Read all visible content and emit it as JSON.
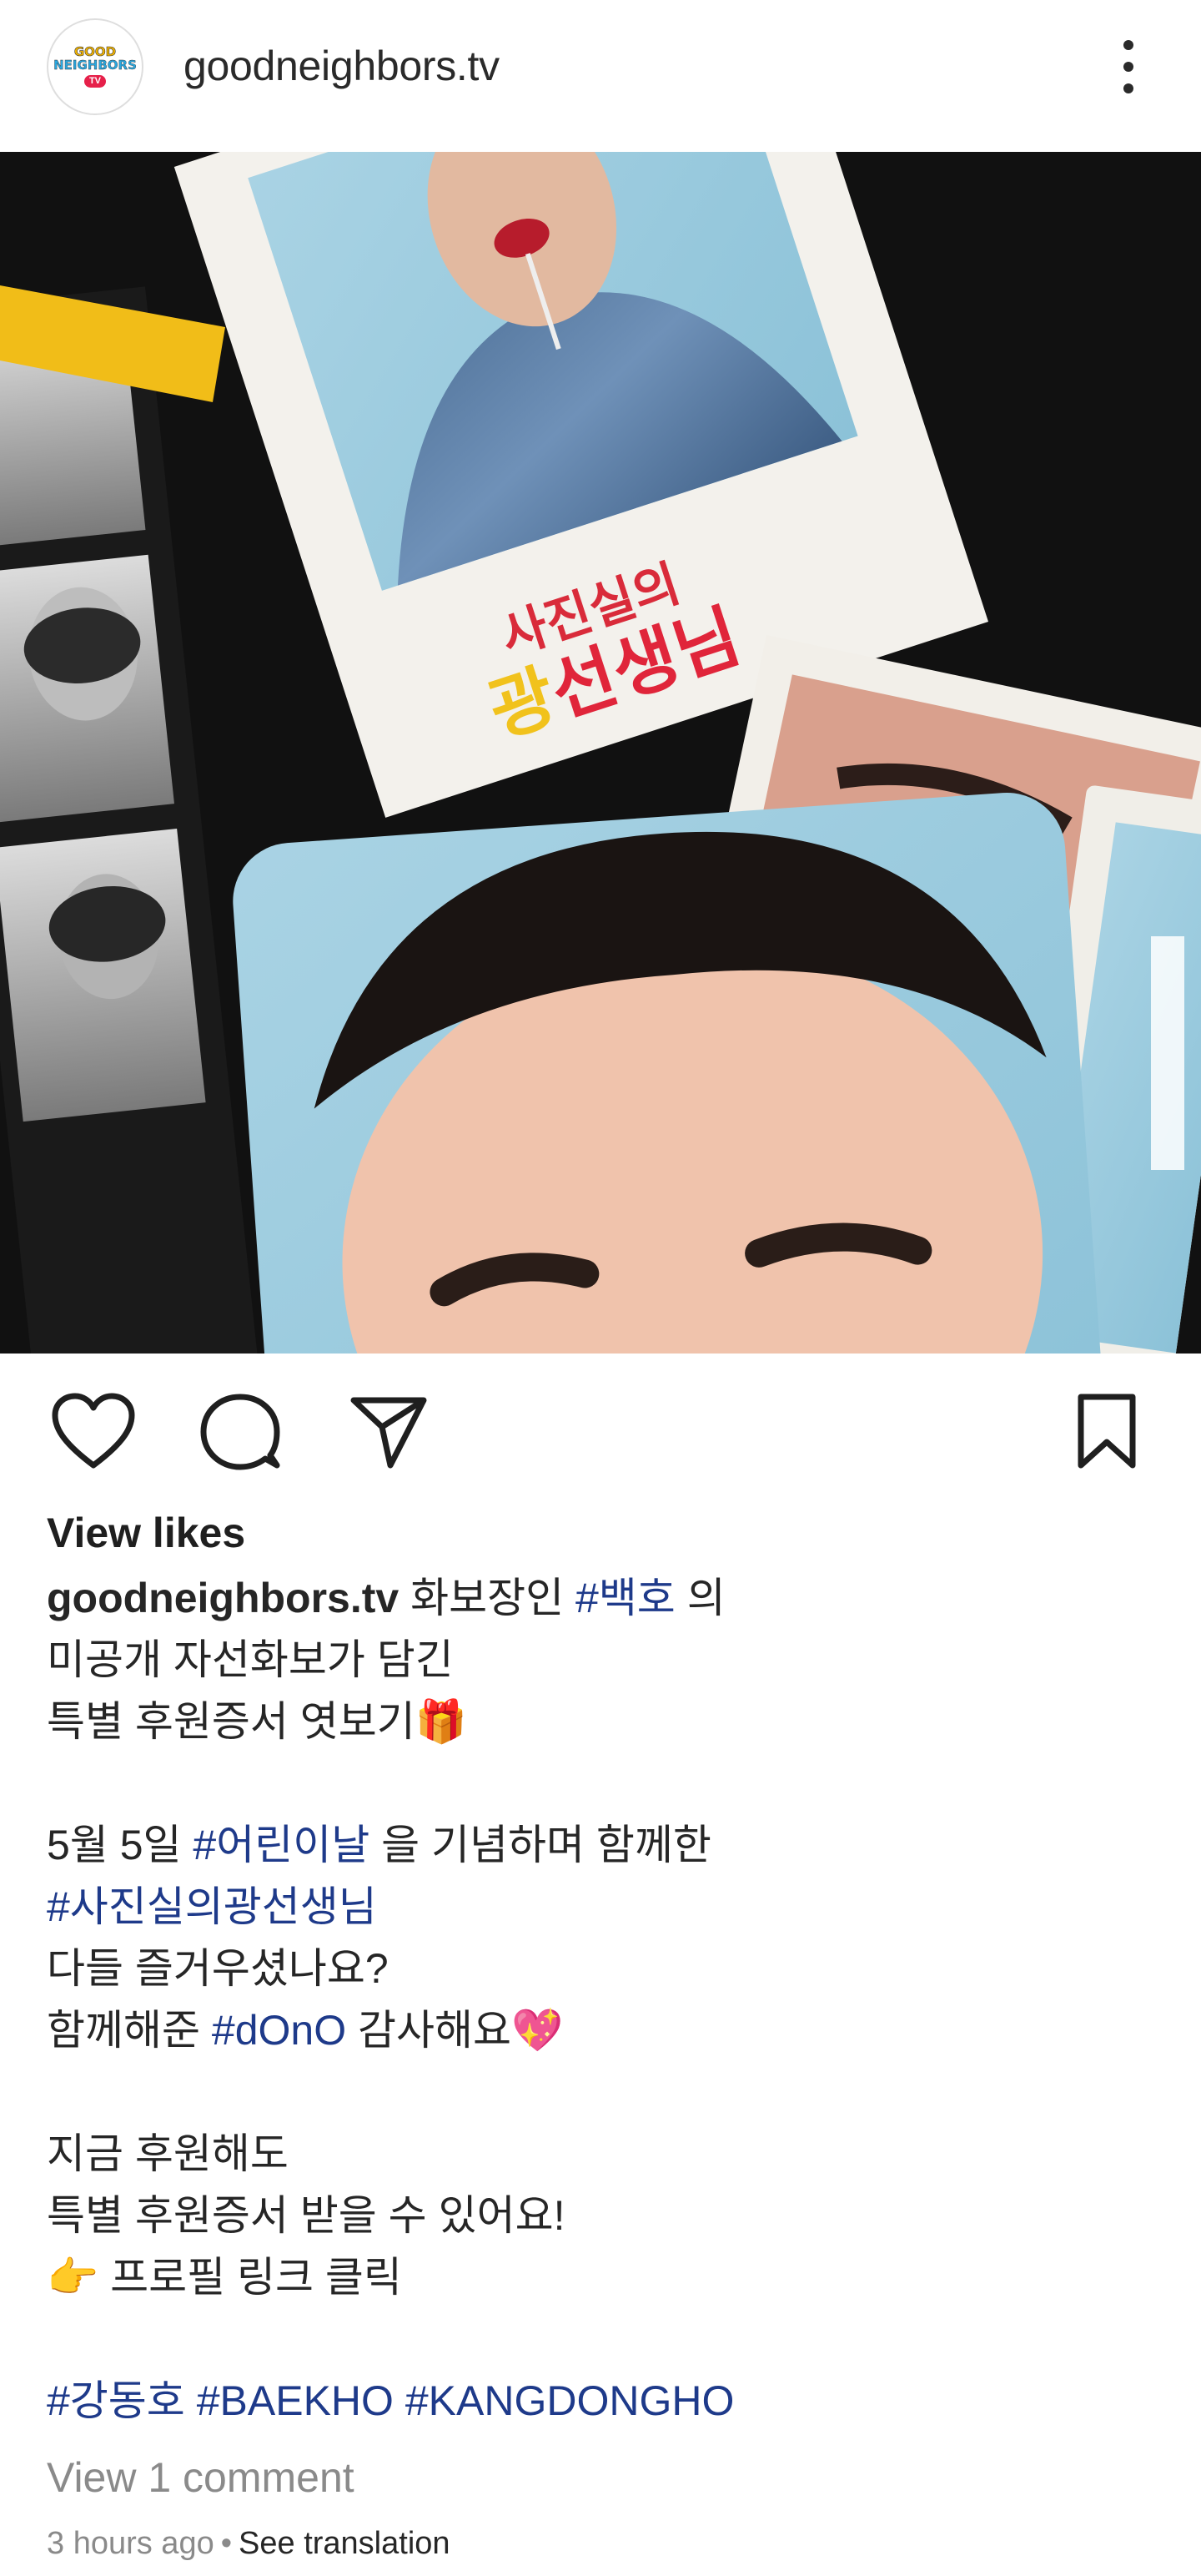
{
  "header": {
    "avatar_text": [
      "GOOD",
      "NEIGHBORS",
      "TV"
    ],
    "username": "goodneighbors.tv"
  },
  "post": {
    "photo_text": [
      "사진실의",
      "광",
      "선생님"
    ],
    "view_likes": "View likes",
    "caption": {
      "username": "goodneighbors.tv",
      "lines": [
        [
          " 화보장인 ",
          {
            "tag": "#백호"
          },
          " 의"
        ],
        [
          "미공개 자선화보가 담긴"
        ],
        [
          "특별 후원증서 엿보기🎁"
        ],
        [],
        [
          "5월 5일 ",
          {
            "tag": "#어린이날"
          },
          " 을 기념하며 함께한"
        ],
        [
          {
            "tag": "#사진실의광선생님"
          }
        ],
        [
          "다들 즐거우셨나요?"
        ],
        [
          "함께해준 ",
          {
            "tag": "#dOnO"
          },
          " 감사해요💖"
        ],
        [],
        [
          "지금 후원해도"
        ],
        [
          "특별 후원증서 받을 수 있어요!"
        ],
        [
          "👉 프로필 링크 클릭"
        ],
        [],
        [
          {
            "tag": "#강동호"
          },
          " ",
          {
            "tag": "#BAEKHO"
          },
          " ",
          {
            "tag": "#KANGDONGHO"
          }
        ]
      ]
    },
    "view_comments": "View 1 comment",
    "time": "3 hours ago",
    "separator": "•",
    "see_translation": "See translation"
  },
  "icons": {
    "more": "more-vertical-icon",
    "like": "heart-icon",
    "comment": "comment-bubble-icon",
    "share": "paper-plane-icon",
    "save": "bookmark-icon"
  },
  "colors": {
    "hashtag": "#1e3a8a",
    "muted": "#8a8a8a",
    "text": "#262626"
  }
}
